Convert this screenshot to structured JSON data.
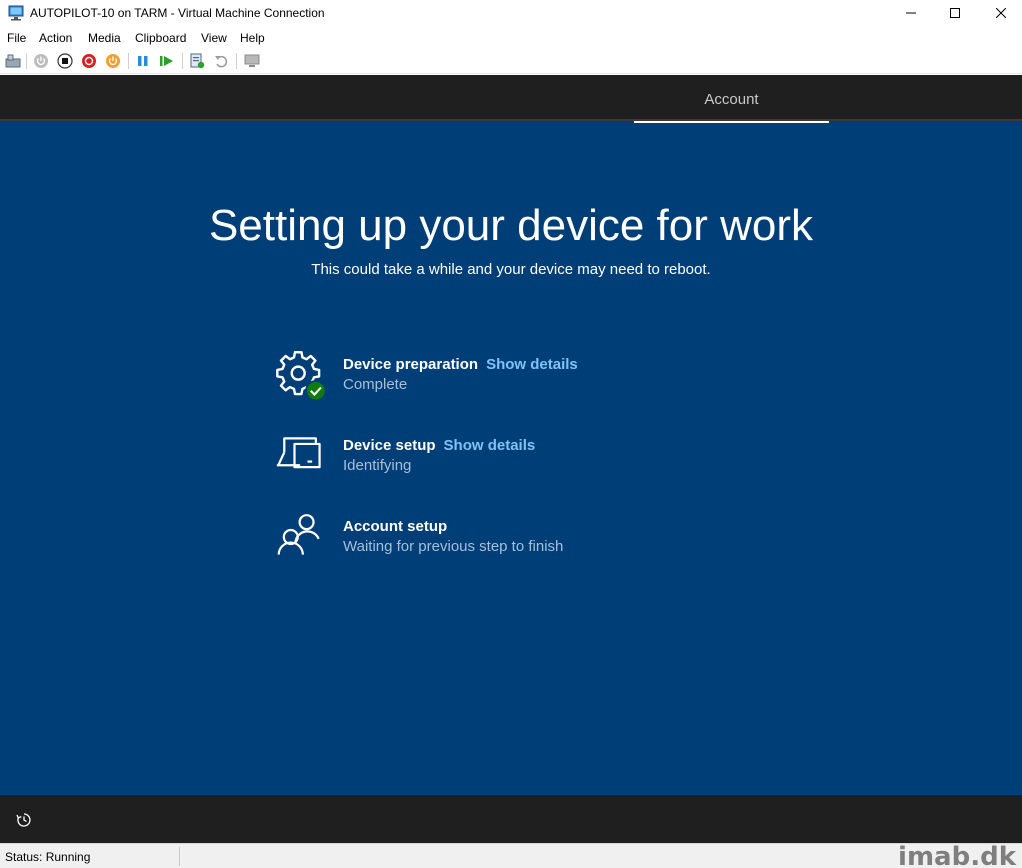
{
  "window": {
    "title": "AUTOPILOT-10 on TARM - Virtual Machine Connection",
    "app_icon": "monitor-icon",
    "controls": [
      "minimize-icon",
      "maximize-icon",
      "close-icon"
    ]
  },
  "menu": {
    "items": [
      "File",
      "Action",
      "Media",
      "Clipboard",
      "View",
      "Help"
    ]
  },
  "toolbar": {
    "buttons": [
      "ctrl-alt-del-icon",
      "start-icon",
      "turn-off-icon",
      "shut-down-icon",
      "power-icon",
      "pause-icon",
      "resume-icon",
      "checkpoint-icon",
      "revert-icon",
      "enhanced-session-icon"
    ]
  },
  "guest": {
    "header_tab": "Account",
    "title": "Setting up your device for work",
    "subtitle": "This could take a while and your device may need to reboot.",
    "steps": [
      {
        "title": "Device preparation",
        "link": "Show details",
        "status": "Complete",
        "icon": "gear-check-icon"
      },
      {
        "title": "Device setup",
        "link": "Show details",
        "status": "Identifying",
        "icon": "devices-icon"
      },
      {
        "title": "Account setup",
        "link": "",
        "status": "Waiting for previous step to finish",
        "icon": "people-icon"
      }
    ],
    "footer_icon": "accessibility-icon",
    "colors": {
      "background": "#003e78",
      "header": "#1f1f1f",
      "link": "#7fc3f4",
      "status": "#a8bfd8",
      "check": "#107c10"
    }
  },
  "status": {
    "text": "Status: Running",
    "watermark": "imab.dk"
  }
}
